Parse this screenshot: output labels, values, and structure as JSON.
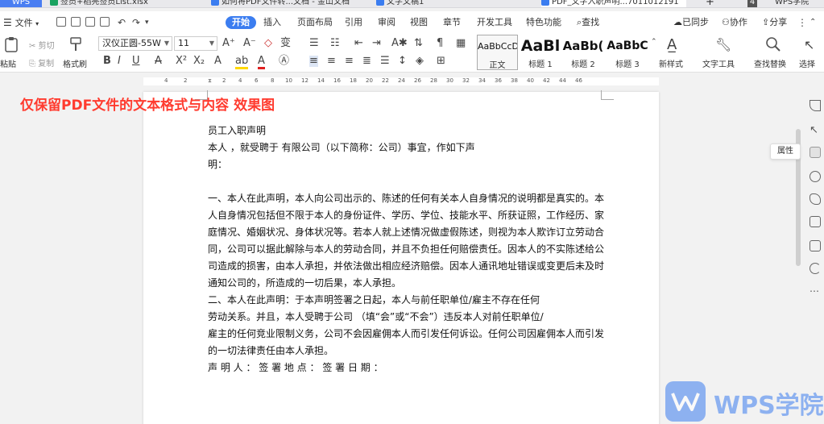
{
  "tabs": {
    "wps": "WPS",
    "items": [
      {
        "label": "签员+稻亮签员List.xlsx",
        "color": "#1aa260"
      },
      {
        "label": "如何将PDF文件转...文档 - 金山文档",
        "color": "#3b7df0"
      },
      {
        "label": "文字文稿1",
        "color": "#3b7df0"
      },
      {
        "label": "PDF_文字入职声明...7011012191",
        "color": "#3b7df0"
      }
    ],
    "plus": "+",
    "count": "4",
    "account": "WPS学院"
  },
  "menu": {
    "file": "文件",
    "start": "开始",
    "items": [
      "插入",
      "页面布局",
      "引用",
      "审阅",
      "视图",
      "章节",
      "开发工具",
      "特色功能"
    ],
    "search": "查找",
    "sync": "已同步",
    "collab": "协作",
    "share": "分享"
  },
  "ribbon": {
    "paste": "粘贴",
    "cut": "剪切",
    "copy": "复制",
    "format_painter": "格式刷",
    "font_name": "汉仪正圆-55W",
    "font_size": "11",
    "styles": [
      {
        "sample": "AaBbCcD",
        "name": "正文",
        "selected": true
      },
      {
        "sample": "AaBl",
        "name": "标题 1",
        "selected": false
      },
      {
        "sample": "AaBb(",
        "name": "标题 2",
        "selected": false
      },
      {
        "sample": "AaBbC",
        "name": "标题 3",
        "selected": false
      }
    ],
    "new_style": "新样式",
    "text_tools": "文字工具",
    "find_replace": "查找替换",
    "select": "选择"
  },
  "ruler": {
    "ticks": [
      "4",
      "2",
      "2",
      "4",
      "6",
      "8",
      "10",
      "12",
      "14",
      "16",
      "18",
      "20",
      "22",
      "24",
      "26",
      "28",
      "30",
      "32",
      "34",
      "36",
      "38",
      "40",
      "42",
      "44",
      "46"
    ]
  },
  "caption": "仅保留PDF文件的文本格式与内容  效果图",
  "document": {
    "lines": [
      "员工入职声明",
      "本人 ，就受聘于 有限公司（以下简称：公司）事宜，作如下声",
      "明：",
      "",
      "一、本人在此声明，本人向公司出示的、陈述的任何有关本人自身情况的说明都是真实的。本",
      "人自身情况包括但不限于本人的身份证件、学历、学位、技能水平、所获证照，工作经历、家",
      "庭情况、婚姻状况、身体状况等。若本人就上述情况做虚假陈述，则视为本人欺诈订立劳动合",
      "同，公司可以据此解除与本人的劳动合同，并且不负担任何赔偿责任。因本人的不实陈述给公",
      "司造成的损害，由本人承担，并依法做出相应经济赔偿。因本人通讯地址错误或变更后未及时",
      "通知公司的，所造成的一切后果，本人承担。",
      "二、本人在此声明：于本声明签署之日起，本人与前任职单位/雇主不存在任何",
      "劳动关系。并且，本人受聘于公司            （填“会”或“不会”）违反本人对前任职单位/",
      "雇主的任何竞业限制义务，公司不会因雇佣本人而引发任何诉讼。任何公司因雇佣本人而引发",
      "的一切法律责任由本人承担。",
      "声 明 人 ：  签 署 地 点 ：  签 署 日 期 ："
    ]
  },
  "sidebar": {
    "tooltip": "属性"
  },
  "watermark": {
    "text": "WPS学院"
  }
}
